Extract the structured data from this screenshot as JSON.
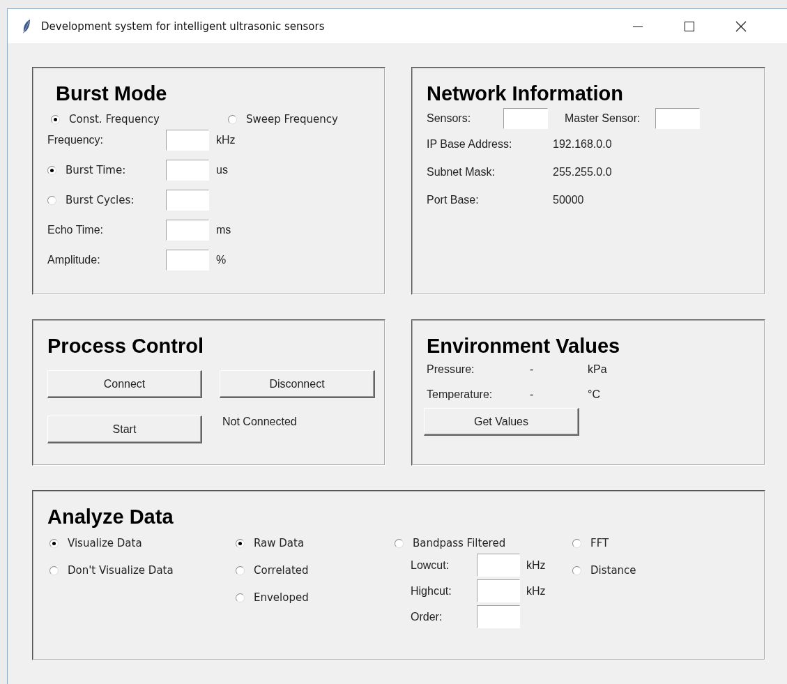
{
  "window": {
    "title": "Development system for intelligent ultrasonic sensors"
  },
  "burst_mode": {
    "title": "Burst Mode",
    "modes": [
      {
        "label": "Const. Frequency",
        "selected": true
      },
      {
        "label": "Sweep Frequency",
        "selected": false
      }
    ],
    "rows": [
      {
        "kind": "label",
        "label": "Frequency:",
        "unit": "kHz"
      },
      {
        "kind": "radio",
        "label": "Burst Time:",
        "selected": true,
        "unit": "us"
      },
      {
        "kind": "radio",
        "label": "Burst Cycles:",
        "selected": false
      },
      {
        "kind": "label",
        "label": "Echo Time:",
        "unit": "ms"
      },
      {
        "kind": "label",
        "label": "Amplitude:",
        "unit": "%"
      }
    ]
  },
  "network_information": {
    "title": "Network Information",
    "sensors_label": "Sensors:",
    "master_sensor_label": "Master Sensor:",
    "rows": [
      {
        "label": "IP Base Address:",
        "value": "192.168.0.0"
      },
      {
        "label": "Subnet Mask:",
        "value": "255.255.0.0"
      },
      {
        "label": "Port Base:",
        "value": "50000"
      }
    ]
  },
  "process_control": {
    "title": "Process Control",
    "buttons": [
      "Connect",
      "Disconnect",
      "Start"
    ],
    "status": "Not Connected"
  },
  "environment_values": {
    "title": "Environment Values",
    "rows": [
      {
        "label": "Pressure:",
        "value": "-",
        "unit": "kPa"
      },
      {
        "label": "Temperature:",
        "value": "-",
        "unit": "°C"
      }
    ],
    "button": "Get Values"
  },
  "analyze_data": {
    "title": "Analyze Data",
    "visualize": [
      {
        "label": "Visualize Data",
        "selected": true
      },
      {
        "label": "Don't Visualize Data",
        "selected": false
      }
    ],
    "data_modes": [
      {
        "label": "Raw Data",
        "selected": true
      },
      {
        "label": "Correlated",
        "selected": false
      },
      {
        "label": "Enveloped",
        "selected": false
      }
    ],
    "bandpass": {
      "label": "Bandpass Filtered",
      "selected": false,
      "fields": [
        {
          "label": "Lowcut:",
          "unit": "kHz"
        },
        {
          "label": "Highcut:",
          "unit": "kHz"
        },
        {
          "label": "Order:"
        }
      ]
    },
    "other_modes": [
      {
        "label": "FFT",
        "selected": false
      },
      {
        "label": "Distance",
        "selected": false
      }
    ]
  }
}
